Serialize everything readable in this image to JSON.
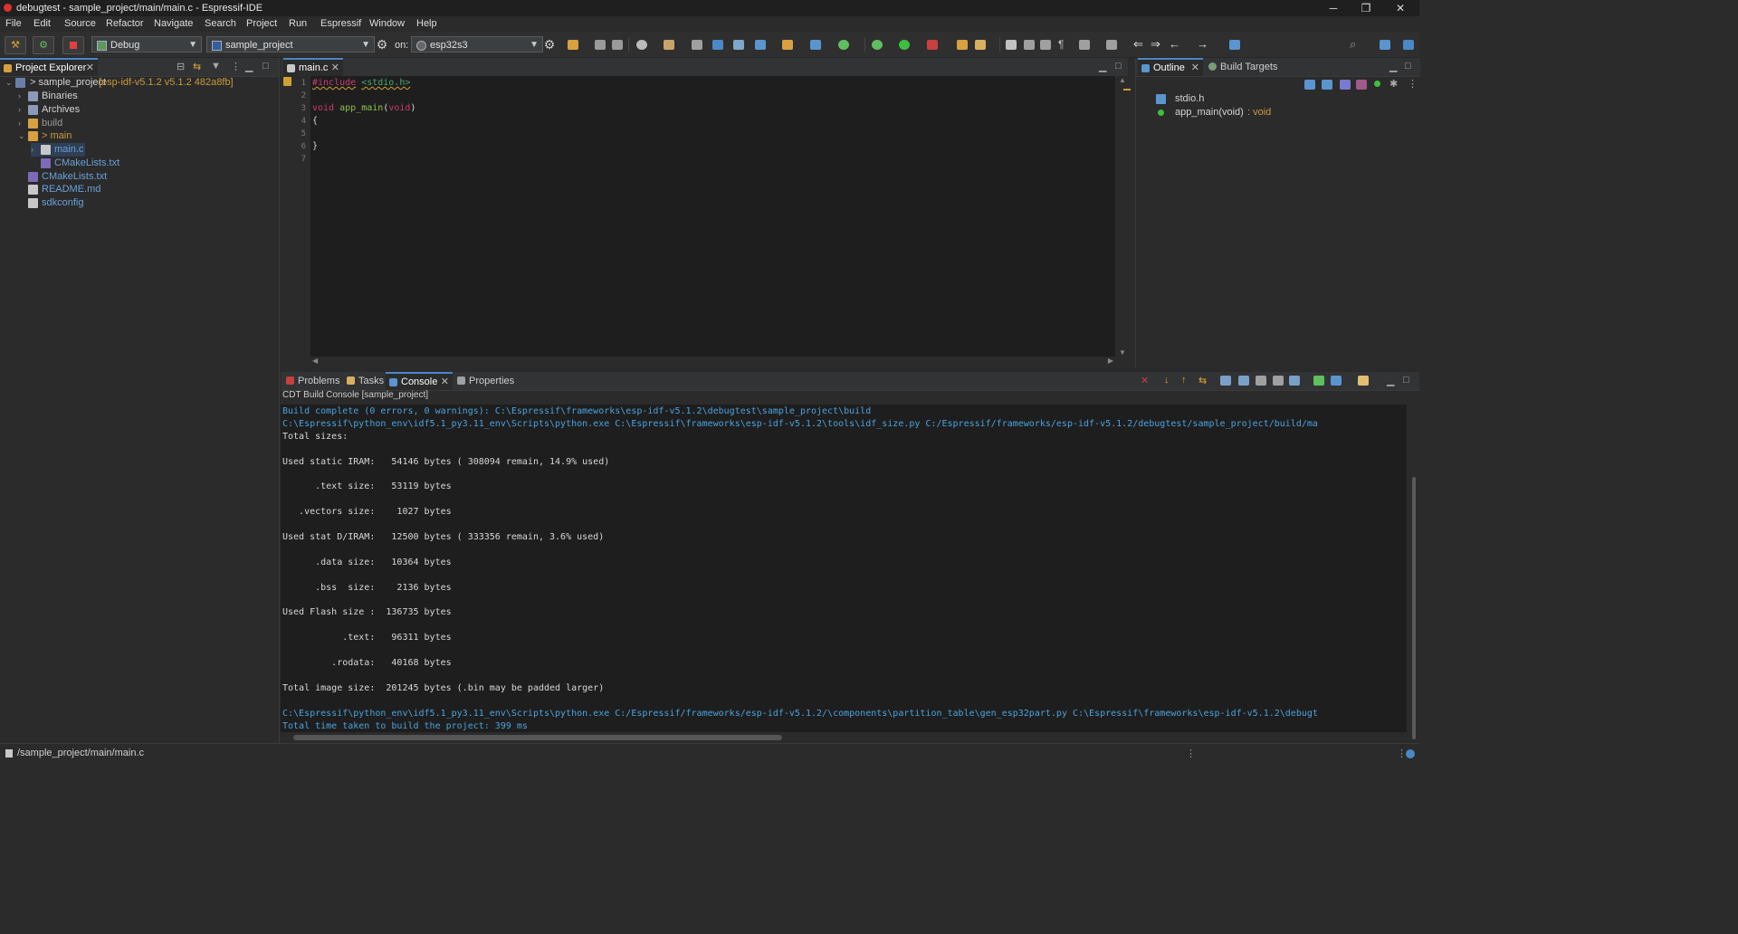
{
  "window": {
    "title": "debugtest - sample_project/main/main.c - Espressif-IDE",
    "minimize": "─",
    "maximize": "❐",
    "close": "✕"
  },
  "menu": [
    "File",
    "Edit",
    "Source",
    "Refactor",
    "Navigate",
    "Search",
    "Project",
    "Run",
    "Espressif",
    "Window",
    "Help"
  ],
  "toolbar": {
    "launch_mode": "Debug",
    "launch_config": "sample_project",
    "on_label": "on:",
    "target": "esp32s3"
  },
  "project_explorer": {
    "tab": "Project Explorer",
    "tree": [
      {
        "label": "> sample_project",
        "decor": "[esp-idf-v5.1.2 v5.1.2 482a8fb]"
      },
      {
        "label": "Binaries"
      },
      {
        "label": "Archives"
      },
      {
        "label": "build"
      },
      {
        "label": "> main"
      },
      {
        "label": "main.c"
      },
      {
        "label": "CMakeLists.txt"
      },
      {
        "label": "CMakeLists.txt"
      },
      {
        "label": "README.md"
      },
      {
        "label": "sdkconfig"
      }
    ]
  },
  "editor": {
    "tab": "main.c",
    "line_numbers": [
      "1",
      "2",
      "3",
      "4",
      "5",
      "6",
      "7"
    ],
    "code": {
      "include_kw": "#include",
      "include_file": "<stdio.h>",
      "void_kw": "void",
      "fn_name": "app_main",
      "param_kw": "void",
      "open_paren": "(",
      "close_paren": ")",
      "open_brace": "{",
      "close_brace": "}"
    }
  },
  "outline": {
    "tabs": [
      "Outline",
      "Build Targets"
    ],
    "items": [
      {
        "label": "stdio.h"
      },
      {
        "label": "app_main(void)",
        "type": " : void"
      }
    ]
  },
  "bottom_panel": {
    "tabs": [
      "Problems",
      "Tasks",
      "Console",
      "Properties"
    ],
    "console_title": "CDT Build Console [sample_project]",
    "lines": [
      {
        "text": "Build complete (0 errors, 0 warnings): C:\\Espressif\\frameworks\\esp-idf-v5.1.2\\debugtest\\sample_project\\build",
        "cmd": true
      },
      {
        "text": "C:\\Espressif\\python_env\\idf5.1_py3.11_env\\Scripts\\python.exe C:\\Espressif\\frameworks\\esp-idf-v5.1.2\\tools\\idf_size.py C:/Espressif/frameworks/esp-idf-v5.1.2/debugtest/sample_project/build/ma",
        "cmd": true
      },
      {
        "text": "Total sizes:",
        "cmd": false
      },
      {
        "text": "",
        "cmd": false
      },
      {
        "text": "Used static IRAM:   54146 bytes ( 308094 remain, 14.9% used)",
        "cmd": false
      },
      {
        "text": "",
        "cmd": false
      },
      {
        "text": "      .text size:   53119 bytes",
        "cmd": false
      },
      {
        "text": "",
        "cmd": false
      },
      {
        "text": "   .vectors size:    1027 bytes",
        "cmd": false
      },
      {
        "text": "",
        "cmd": false
      },
      {
        "text": "Used stat D/IRAM:   12500 bytes ( 333356 remain, 3.6% used)",
        "cmd": false
      },
      {
        "text": "",
        "cmd": false
      },
      {
        "text": "      .data size:   10364 bytes",
        "cmd": false
      },
      {
        "text": "",
        "cmd": false
      },
      {
        "text": "      .bss  size:    2136 bytes",
        "cmd": false
      },
      {
        "text": "",
        "cmd": false
      },
      {
        "text": "Used Flash size :  136735 bytes",
        "cmd": false
      },
      {
        "text": "",
        "cmd": false
      },
      {
        "text": "           .text:   96311 bytes",
        "cmd": false
      },
      {
        "text": "",
        "cmd": false
      },
      {
        "text": "         .rodata:   40168 bytes",
        "cmd": false
      },
      {
        "text": "",
        "cmd": false
      },
      {
        "text": "Total image size:  201245 bytes (.bin may be padded larger)",
        "cmd": false
      },
      {
        "text": "",
        "cmd": false
      },
      {
        "text": "C:\\Espressif\\python_env\\idf5.1_py3.11_env\\Scripts\\python.exe C:/Espressif/frameworks/esp-idf-v5.1.2/\\components\\partition_table\\gen_esp32part.py C:\\Espressif\\frameworks\\esp-idf-v5.1.2\\debugt",
        "cmd": true
      },
      {
        "text": "Total time taken to build the project: 399 ms",
        "cmd": true
      }
    ]
  },
  "statusbar": {
    "path": "/sample_project/main/main.c"
  },
  "colors": {
    "accent": "#4a88c7",
    "console_cmd": "#4aa3df",
    "keyword": "#cc3b6e",
    "function": "#8bc34a",
    "decoration": "#c89b3c"
  }
}
